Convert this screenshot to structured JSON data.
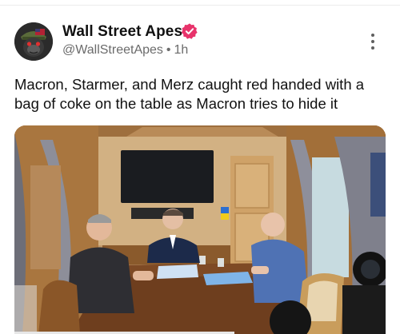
{
  "post": {
    "author": {
      "name": "Wall Street Apes",
      "handle": "@WallStreetApes",
      "time": "1h",
      "separator": "•"
    },
    "text": "Macron, Starmer, and Merz caught red handed with a bag of coke on the table as Macron tries to hide it",
    "media": {
      "kind": "photo"
    }
  },
  "icons": {
    "verified": "verified-badge-icon",
    "more": "more-options-icon",
    "avatar": "gorilla-avatar"
  },
  "colors": {
    "verified_badge": "#e8336b",
    "text_primary": "#111111",
    "text_secondary": "#6b6b6b",
    "background": "#ffffff"
  }
}
